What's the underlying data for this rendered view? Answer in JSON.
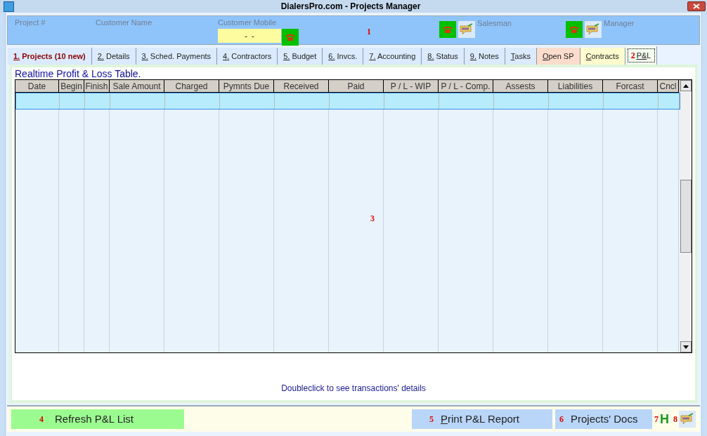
{
  "window": {
    "title": "DialersPro.com - Projects Manager"
  },
  "header": {
    "project_label": "Project #",
    "customer_name_label": "Customer Name",
    "customer_mobile_label": "Customer Mobile",
    "customer_mobile_value": "-  -",
    "marker": "1",
    "salesman_label": "Salesman",
    "manager_label": "Manager"
  },
  "tabs": [
    {
      "label": "1. Projects (10 new)",
      "selected": false,
      "color": "#dbeafe",
      "emphasis": true
    },
    {
      "label": "2. Details",
      "selected": false,
      "color": "#dbeafe",
      "emphasis": false
    },
    {
      "label": "3. Sched. Payments",
      "selected": false,
      "color": "#dbeafe",
      "emphasis": false
    },
    {
      "label": "4. Contractors",
      "selected": false,
      "color": "#dbeafe",
      "emphasis": false
    },
    {
      "label": "5. Budget",
      "selected": false,
      "color": "#dbeafe",
      "emphasis": false
    },
    {
      "label": "6. Invcs.",
      "selected": false,
      "color": "#dbeafe",
      "emphasis": false
    },
    {
      "label": "7. Accounting",
      "selected": false,
      "color": "#dbeafe",
      "emphasis": false
    },
    {
      "label": "8. Status",
      "selected": false,
      "color": "#dbeafe",
      "emphasis": false
    },
    {
      "label": "9. Notes",
      "selected": false,
      "color": "#dbeafe",
      "emphasis": false
    },
    {
      "label": "Tasks",
      "selected": false,
      "color": "#dbeafe",
      "emphasis": false
    },
    {
      "label": "Open SP",
      "selected": false,
      "color": "#fcdccc",
      "emphasis": false
    },
    {
      "label": "Contracts",
      "selected": false,
      "color": "#fefccf",
      "emphasis": false
    },
    {
      "label": "P&L",
      "selected": true,
      "color": "#f4fdf0",
      "emphasis": false,
      "marker": "2"
    }
  ],
  "panel": {
    "title": "Realtime Profit & Loss  Table.",
    "marker": "3",
    "hint": "Doubleclick to see transactions' details"
  },
  "table": {
    "columns": [
      "Date",
      "Begin",
      "Finish",
      "Sale Amount",
      "Charged",
      "Pymnts Due",
      "Received",
      "Paid",
      "P / L - WIP",
      "P / L - Comp.",
      "Assests",
      "Liabilities",
      "Forcast",
      "Cncl"
    ],
    "rows": [
      {
        "selected": true
      }
    ]
  },
  "footer": {
    "refresh": {
      "marker": "4",
      "label": "Refresh P&L List"
    },
    "print": {
      "marker": "5",
      "label": "Print P&L Report"
    },
    "docs": {
      "marker": "6",
      "label": "Projects' Docs"
    },
    "help": {
      "marker": "7",
      "label": "H"
    },
    "sms": {
      "marker": "8"
    }
  }
}
